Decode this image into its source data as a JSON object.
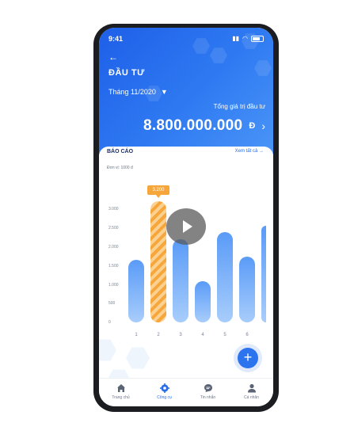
{
  "status_bar": {
    "time": "9:41"
  },
  "header": {
    "title": "ĐẦU TƯ",
    "month": "Tháng 11/2020",
    "total_label": "Tổng giá trị đầu tư",
    "total_value": "8.800.000.000",
    "currency": "Đ"
  },
  "report": {
    "title": "BÁO CÁO",
    "see_all": "Xem tất cả →",
    "unit": "Đơn vị: 1000 đ",
    "tooltip": "3.200"
  },
  "chart_data": {
    "type": "bar",
    "categories": [
      "1",
      "2",
      "3",
      "4",
      "5",
      "6"
    ],
    "y_tick_labels": [
      "3.000",
      "2.500",
      "2.000",
      "1.500",
      "1.000",
      "500",
      "0"
    ],
    "values": [
      1650,
      3200,
      2200,
      1100,
      2400,
      1750
    ],
    "highlighted_category": "2"
  },
  "nav": {
    "items": [
      {
        "label": "Trang chủ",
        "icon": "home-icon"
      },
      {
        "label": "Công cụ",
        "icon": "gear-icon"
      },
      {
        "label": "Tin nhắn",
        "icon": "chat-icon"
      },
      {
        "label": "Cá nhân",
        "icon": "user-icon"
      }
    ]
  },
  "colors": {
    "primary": "#2c73ee",
    "highlight": "#f6a63a",
    "bar": "#5a9bf7"
  }
}
